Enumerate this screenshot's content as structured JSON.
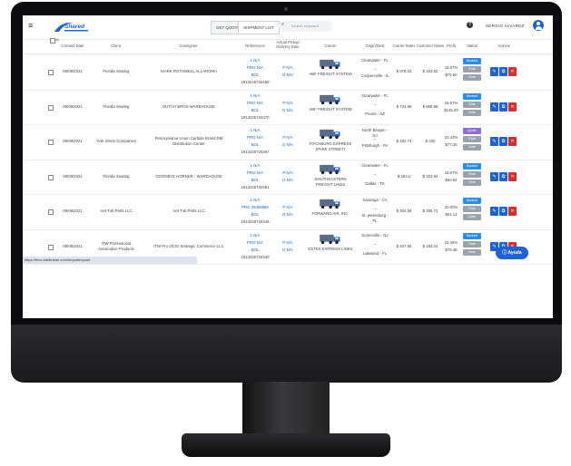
{
  "header": {
    "logo_text": "Shared",
    "tabs": [
      "GET QUOTE",
      "SHIPMENT LIST"
    ],
    "search_placeholder": "Search shipment",
    "username": "SERGIO ALVAREZ"
  },
  "columns": [
    "Created Date",
    "Client",
    "Consignee",
    "References",
    "Actual Pickup Delivery Date",
    "Carrier",
    "Origin/Dest",
    "Carrier Rates",
    "Customer Rates",
    "Profit",
    "Status",
    "Actions"
  ],
  "select_all_label": "All",
  "rows": [
    {
      "date": "09/08/2021",
      "client": "Florida Seating",
      "consignee": "MARK ROTHWELL ALLAROMA",
      "ref1": "1 N/A",
      "ref2": "PRO N/A",
      "ref3": "BOL",
      "ref4": "1913225734459",
      "pd1": "P N/A",
      "pd2": "D N/A",
      "carrier": "ABF FREIGHT SYSTEM",
      "origin": "Clearwater - FL",
      "dest": "Coopersville - IL",
      "carrier_rate": "$ 378.02",
      "customer_rate": "$ 453.62",
      "profit_pct": "16.67%",
      "profit_amt": "$75.60",
      "status": [
        "Booked",
        "Rate",
        "Note"
      ],
      "status_colors": [
        "#2a8ee8",
        "#9aa3ad",
        "#9aa3ad"
      ]
    },
    {
      "date": "09/08/2021",
      "client": "Florida Seating",
      "consignee": "DUTCH BROS WAREHOUSE",
      "ref1": "1 N/A",
      "ref2": "PRO N/A",
      "ref3": "BOL",
      "ref4": "1913225734470",
      "pd1": "P N/A",
      "pd2": "D N/A",
      "carrier": "ABF FREIGHT SYSTEM",
      "origin": "Clearwater - FL",
      "dest": "Peoria - AZ",
      "carrier_rate": "$ 724.98",
      "customer_rate": "$ 869.98",
      "profit_pct": "16.67%",
      "profit_amt": "$145.00",
      "status": [
        "Booked",
        "Rate",
        "Note"
      ],
      "status_colors": [
        "#2a8ee8",
        "#9aa3ad",
        "#9aa3ad"
      ]
    },
    {
      "date": "09/08/2021",
      "client": "York Street Companies",
      "consignee": "Pennsylvania Union Carbide Brand DM Distribution Center",
      "ref1": "1 N/A",
      "ref2": "PRO N/A",
      "ref3": "BOL",
      "ref4": "1913225734467",
      "pd1": "P N/A",
      "pd2": "D N/A",
      "carrier": "FITCHBURG EXPRESS (PARK STREET)",
      "origin": "North Bergen - NJ",
      "dest": "Pittsburgh - PA",
      "carrier_rate": "$ 282.73",
      "customer_rate": "$ 330",
      "profit_pct": "23.43%",
      "profit_amt": "$77.28",
      "status": [
        "Quote",
        "Rate",
        "Note"
      ],
      "status_colors": [
        "#8a6fd6",
        "#9aa3ad",
        "#9aa3ad"
      ]
    },
    {
      "date": "09/08/2021",
      "client": "Florida Seating",
      "consignee": "GOODBYE HORNER - WAREHOUSE",
      "ref1": "1 N/A",
      "ref2": "PRO N/A",
      "ref3": "BOL",
      "ref4": "1913225734451",
      "pd1": "P N/A",
      "pd2": "D N/A",
      "carrier": "SOUTHEASTERN FREIGHT LINES",
      "origin": "Clearwater - FL",
      "dest": "Dallas - TX",
      "carrier_rate": "$ 253.2",
      "customer_rate": "$ 303.84",
      "profit_pct": "16.67%",
      "profit_amt": "$50.64",
      "status": [
        "Booked",
        "Rate",
        "Note"
      ],
      "status_colors": [
        "#2a8ee8",
        "#9aa3ad",
        "#9aa3ad"
      ]
    },
    {
      "date": "09/08/2021",
      "client": "Hot Tub Parts LLC",
      "consignee": "Hot Tub Parts LLC",
      "ref1": "1 N/A",
      "ref2": "PRO 39455988",
      "ref3": "BOL",
      "ref4": "1913225734446",
      "pd1": "P N/A",
      "pd2": "D N/A",
      "carrier": "FORWARD AIR, INC.",
      "origin": "Saratoga - CA",
      "dest": "St. petersburg - FL",
      "carrier_rate": "$ 304.58",
      "customer_rate": "$ 355.72",
      "profit_pct": "20.00%",
      "profit_amt": "$51.14",
      "status": [
        "Booked",
        "Rate",
        "Note"
      ],
      "status_colors": [
        "#2a8ee8",
        "#9aa3ad",
        "#9aa3ad"
      ]
    },
    {
      "date": "09/08/2021",
      "client": "ITW Professional Automotive Products",
      "consignee": "ITW Pro ofC/O Strategic Commerce LLC",
      "ref1": "1 N/A",
      "ref2": "PRO N/A",
      "ref3": "BOL",
      "ref4": "1913225734440",
      "pd1": "P N/A",
      "pd2": "D N/A",
      "carrier": "ESTES EXPRESS LINES",
      "origin": "Somerville - NJ",
      "dest": "Lakeland - FL",
      "carrier_rate": "$ 407.66",
      "customer_rate": "$ 483.04",
      "profit_pct": "23.25%",
      "profit_amt": "$75.38",
      "status": [
        "Booked",
        "Rate",
        "Note"
      ],
      "status_colors": [
        "#2a8ee8",
        "#9aa3ad",
        "#9aa3ad"
      ]
    }
  ],
  "status_url": "https://feco.sitebrame.com/#/quote/quote",
  "ayuda_label": "Ayuda"
}
